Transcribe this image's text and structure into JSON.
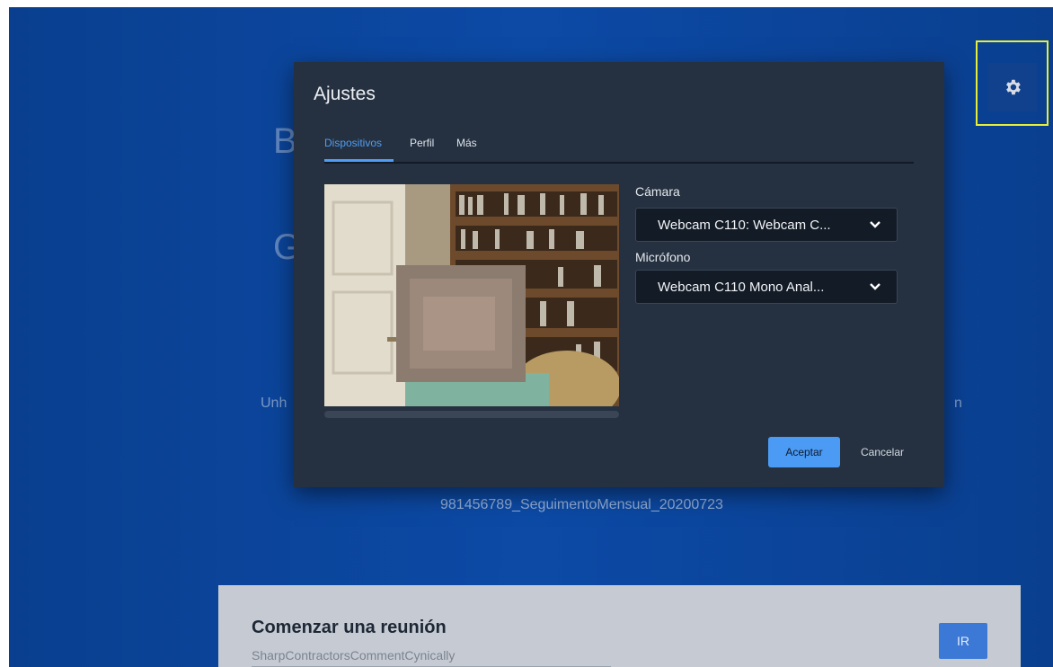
{
  "background": {
    "room_name": "981456789_SeguimentoMensual_20200723",
    "heading_letter_1": "B",
    "heading_letter_2": "G",
    "subtitle_left": "Unh",
    "subtitle_right": "n"
  },
  "settings_button": {
    "icon": "gear-icon"
  },
  "meeting": {
    "title": "Comenzar una reunión",
    "room_value": "SharpContractorsCommentCynically",
    "go_label": "IR"
  },
  "dialog": {
    "title": "Ajustes",
    "tabs": [
      {
        "label": "Dispositivos",
        "active": true
      },
      {
        "label": "Perfil",
        "active": false
      },
      {
        "label": "Más",
        "active": false
      }
    ],
    "camera_label": "Cámara",
    "camera_value": "Webcam C110: Webcam C...",
    "mic_label": "Micrófono",
    "mic_value": "Webcam C110 Mono Anal...",
    "accept_label": "Aceptar",
    "cancel_label": "Cancelar"
  },
  "colors": {
    "background_blue": "#0c4aa6",
    "dialog_bg": "#253140",
    "accent": "#4f9df4",
    "highlight": "#e5ee3a"
  }
}
